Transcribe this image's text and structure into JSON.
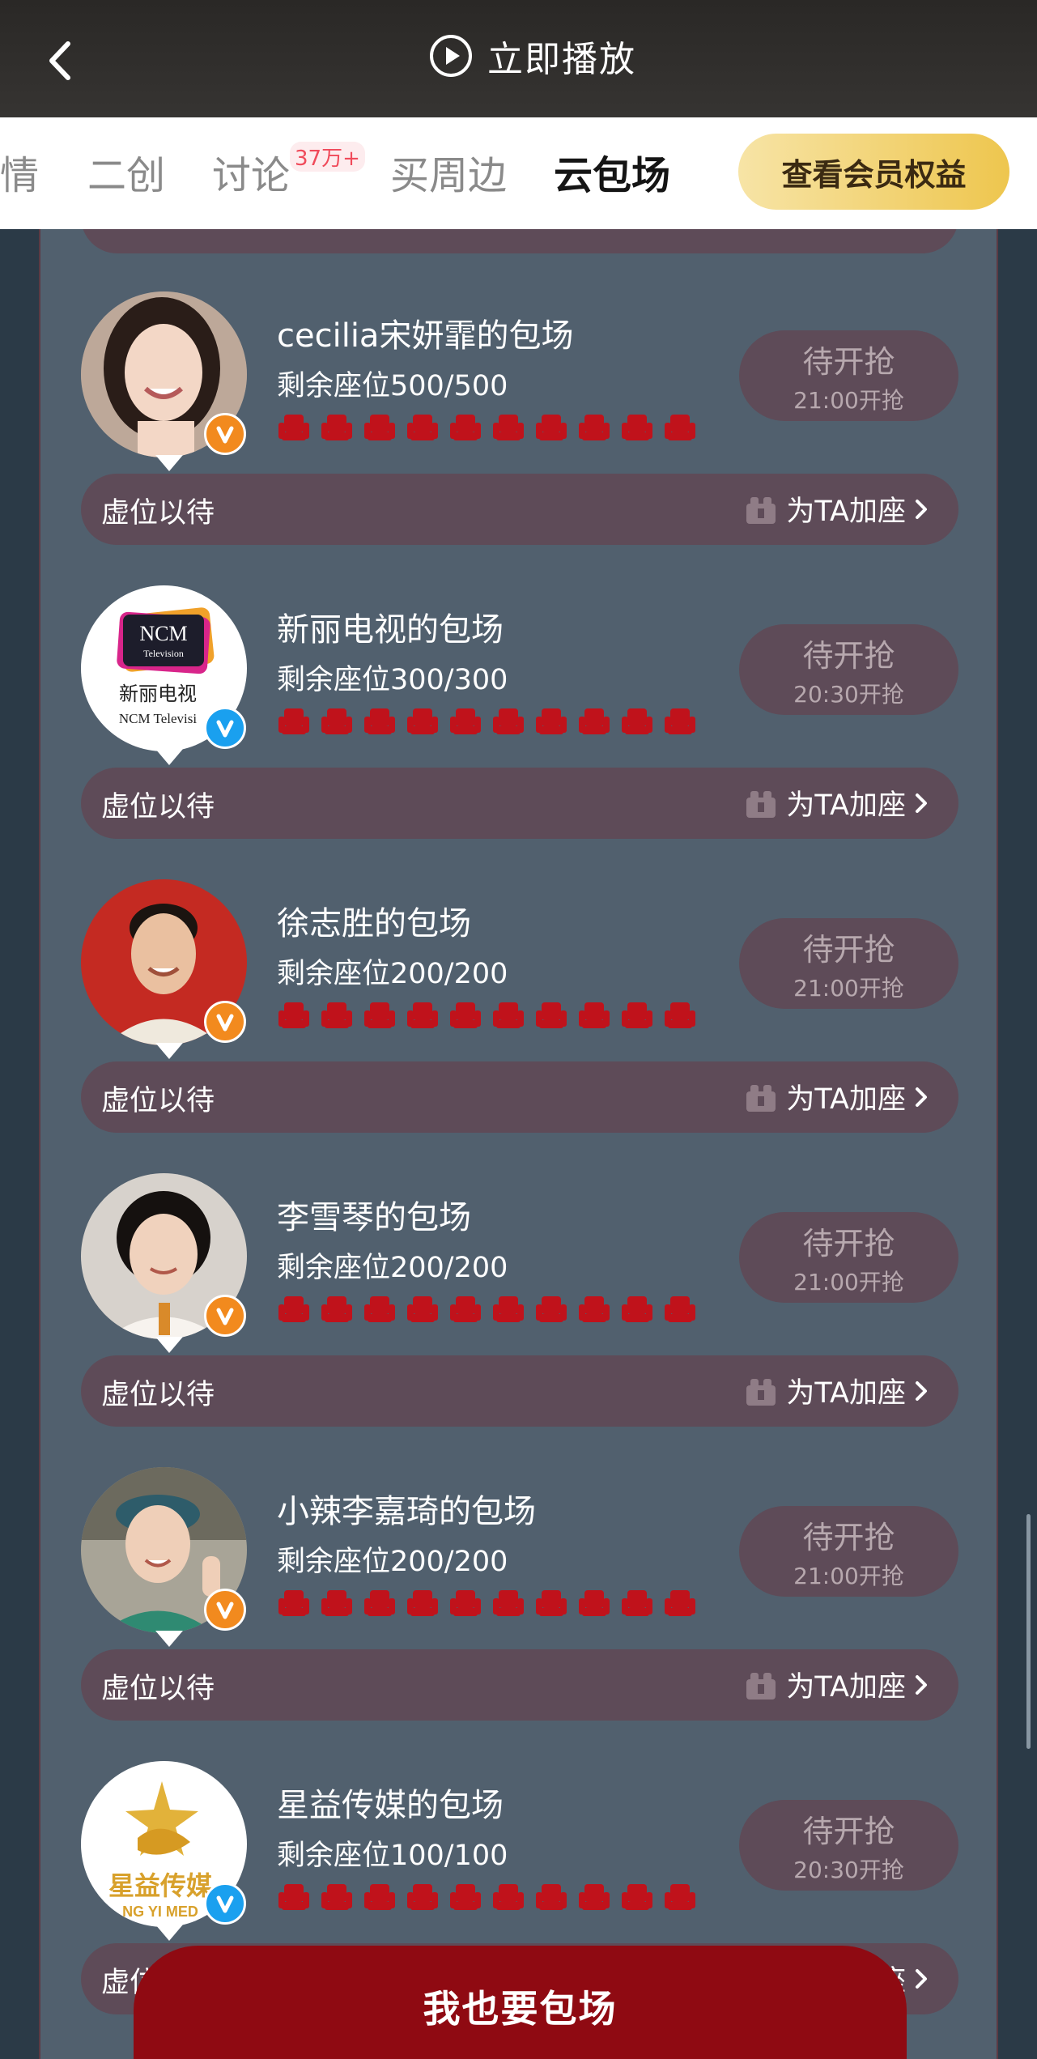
{
  "header": {
    "title": "立即播放"
  },
  "tabs": [
    {
      "label": "情"
    },
    {
      "label": "二创"
    },
    {
      "label": "讨论",
      "badge": "37万+"
    },
    {
      "label": "买周边"
    },
    {
      "label": "云包场",
      "active": true
    }
  ],
  "vip_button": {
    "label": "查看会员权益"
  },
  "cards": [
    {
      "title": "cecilia宋妍霏的包场",
      "seats": "剩余座位500/500",
      "status": "待开抢",
      "time": "21:00开抢",
      "verified_color": "orange",
      "add_left": "虚位以待",
      "add_right": "为TA加座"
    },
    {
      "title": "新丽电视的包场",
      "seats": "剩余座位300/300",
      "status": "待开抢",
      "time": "20:30开抢",
      "verified_color": "blue",
      "add_left": "虚位以待",
      "add_right": "为TA加座",
      "logo_text": {
        "line1": "NCM",
        "line2": "Television",
        "line3": "新丽电视",
        "line4": "NCM Televisi"
      }
    },
    {
      "title": "徐志胜的包场",
      "seats": "剩余座位200/200",
      "status": "待开抢",
      "time": "21:00开抢",
      "verified_color": "orange",
      "add_left": "虚位以待",
      "add_right": "为TA加座"
    },
    {
      "title": "李雪琴的包场",
      "seats": "剩余座位200/200",
      "status": "待开抢",
      "time": "21:00开抢",
      "verified_color": "orange",
      "add_left": "虚位以待",
      "add_right": "为TA加座"
    },
    {
      "title": "小辣李嘉琦的包场",
      "seats": "剩余座位200/200",
      "status": "待开抢",
      "time": "21:00开抢",
      "verified_color": "orange",
      "add_left": "虚位以待",
      "add_right": "为TA加座"
    },
    {
      "title": "星益传媒的包场",
      "seats": "剩余座位100/100",
      "status": "待开抢",
      "time": "20:30开抢",
      "verified_color": "blue",
      "add_left": "虚位以待",
      "add_right": "为TA加座",
      "logo_text": {
        "line1": "星益传媒",
        "line2": "NG YI MED"
      }
    }
  ],
  "bottom_button": {
    "label": "我也要包场"
  },
  "colors": {
    "panel": "#51606e",
    "pill": "#5e4b58",
    "seat_red": "#c0121b",
    "bottom_btn": "#8f0a12",
    "vip_gold": "#eec64e"
  }
}
